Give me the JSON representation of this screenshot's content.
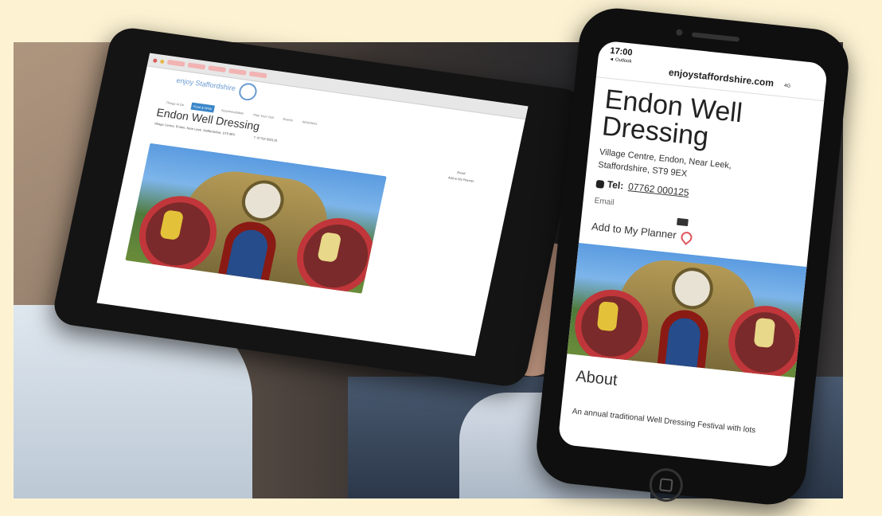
{
  "tablet": {
    "site_logo": "enjoy Staffordshire",
    "nav": [
      "Things to Do",
      "Food & Drink",
      "Accommodation",
      "Plan Your Visit",
      "Events",
      "Attractions"
    ],
    "page_title": "Endon Well Dressing",
    "address": "Village Centre, Endon, Near Leek, Staffordshire, ST9 9EX",
    "tel": "T: 07762 000125",
    "email_label": "Email",
    "planner_label": "Add to My Planner"
  },
  "phone": {
    "time": "17:00",
    "carrier": "◄ Outlook",
    "url": "enjoystaffordshire.com",
    "signal": "4G",
    "title": "Endon Well Dressing",
    "address": "Village Centre, Endon, Near Leek, Staffordshire, ST9 9EX",
    "tel_label": "Tel:",
    "tel_number": "07762 000125",
    "email_label": "Email",
    "planner_label": "Add to My Planner",
    "about_heading": "About",
    "description": "An annual traditional Well Dressing Festival with lots"
  },
  "colors": {
    "background": "#fdf3d3",
    "accent_blue": "#3a86c9",
    "heart": "#e0565e"
  }
}
